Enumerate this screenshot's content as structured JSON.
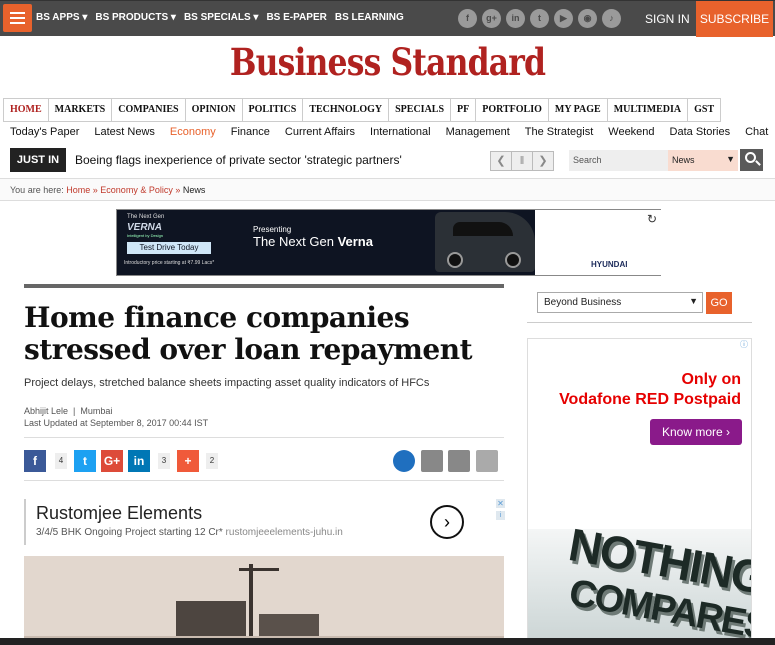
{
  "top": {
    "links": [
      {
        "label": "BS APPS",
        "caret": "▾"
      },
      {
        "label": "BS PRODUCTS",
        "caret": "▾"
      },
      {
        "label": "BS SPECIALS",
        "caret": "▾"
      },
      {
        "label": "BS E-PAPER",
        "caret": ""
      },
      {
        "label": "BS LEARNING",
        "caret": ""
      }
    ],
    "social": [
      "f",
      "g+",
      "in",
      "t",
      "yt",
      "rss",
      "bell"
    ],
    "signin": "SIGN IN",
    "subscribe": "SUBSCRIBE"
  },
  "logo": "Business Standard",
  "nav": [
    "HOME",
    "MARKETS",
    "COMPANIES",
    "OPINION",
    "POLITICS",
    "TECHNOLOGY",
    "SPECIALS",
    "PF",
    "PORTFOLIO",
    "MY PAGE",
    "MULTIMEDIA",
    "GST"
  ],
  "subnav": [
    "Today's Paper",
    "Latest News",
    "Economy",
    "Finance",
    "Current Affairs",
    "International",
    "Management",
    "The Strategist",
    "Weekend",
    "Data Stories",
    "Chat"
  ],
  "justin": {
    "label": "JUST IN",
    "headline": "Boeing flags inexperience of private sector 'strategic partners'"
  },
  "search": {
    "placeholder": "Search",
    "select": "News"
  },
  "breadcrumb": {
    "prefix": "You are here:",
    "home": "Home",
    "section": "Economy & Policy",
    "current": "News",
    "sep": "»"
  },
  "ad_top": {
    "nextgen": "The Next Gen",
    "brand": "VERNA",
    "tagline": "Intelligent by Design",
    "cta": "Test Drive Today",
    "price": "Introductory price starting at ₹7.99 Lacs*",
    "presenting": "Presenting",
    "headline_pre": "The Next Gen",
    "headline_bold": "Verna",
    "maker": "HYUNDAI"
  },
  "article": {
    "headline": "Home finance companies stressed over loan repayment",
    "subhead": "Project delays, stretched balance sheets impacting asset quality indicators of HFCs",
    "author": "Abhijit Lele",
    "location": "Mumbai",
    "updated": "Last Updated at September 8, 2017 00:44 IST",
    "share_counts": {
      "facebook": "4",
      "linkedin": "3",
      "more": "2"
    }
  },
  "ad_inline": {
    "title": "Rustomjee Elements",
    "sub": "3/4/5 BHK Ongoing Project starting 12 Cr*",
    "url": "rustomjeeelements-juhu.in"
  },
  "sidebar": {
    "select": "Beyond Business",
    "go": "GO"
  },
  "ad_right": {
    "line1": "Only on",
    "line2": "Vodafone RED Postpaid",
    "cta": "Know more",
    "slogan1": "NOTHING",
    "slogan2": "COMPARES"
  },
  "colors": {
    "brand_red": "#b02220",
    "accent_orange": "#e8622c"
  }
}
